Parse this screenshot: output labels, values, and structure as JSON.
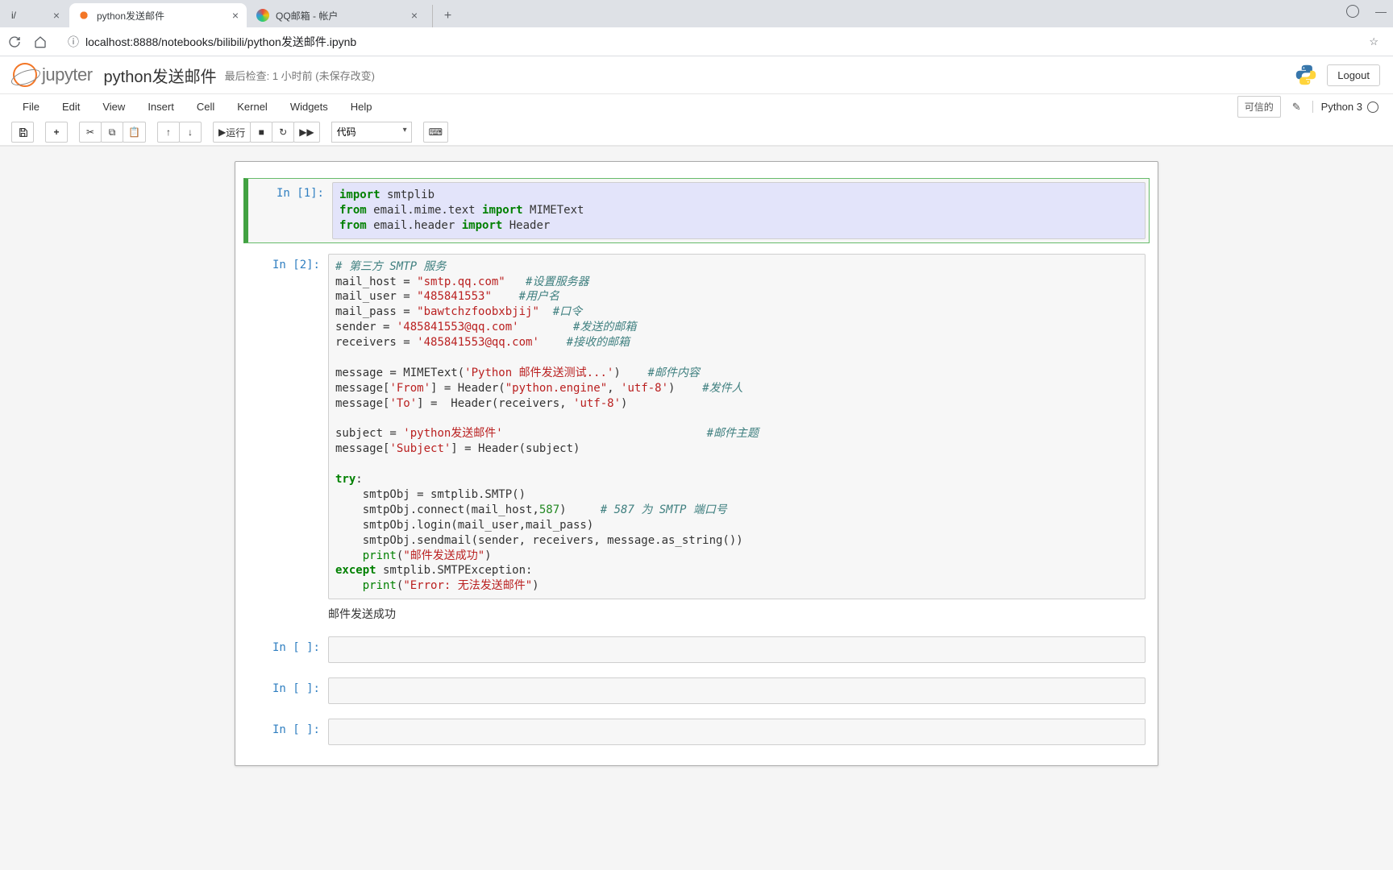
{
  "browser": {
    "tabs": [
      {
        "label": "i/",
        "active": false
      },
      {
        "label": "python发送邮件",
        "active": true
      },
      {
        "label": "QQ邮箱 - 帐户",
        "active": false
      }
    ],
    "url": "localhost:8888/notebooks/bilibili/python发送邮件.ipynb"
  },
  "jupyter": {
    "brand": "jupyter",
    "notebook_name": "python发送邮件",
    "checkpoint": "最后检查: 1 小时前 (未保存改变)",
    "logout": "Logout",
    "menus": [
      "File",
      "Edit",
      "View",
      "Insert",
      "Cell",
      "Kernel",
      "Widgets",
      "Help"
    ],
    "trusted": "可信的",
    "kernel_name": "Python 3",
    "toolbar": {
      "run_label": "运行",
      "cell_type": "代码"
    }
  },
  "cells": [
    {
      "prompt": "In [1]:",
      "selected": true,
      "source": {
        "l1_kw1": "import",
        "l1_rest": " smtplib",
        "l2_kw1": "from",
        "l2_mid": " email.mime.text ",
        "l2_kw2": "import",
        "l2_rest": " MIMEText",
        "l3_kw1": "from",
        "l3_mid": " email.header ",
        "l3_kw2": "import",
        "l3_rest": " Header"
      }
    },
    {
      "prompt": "In [2]:",
      "source_html": true,
      "output": "邮件发送成功"
    },
    {
      "prompt": "In [ ]:",
      "empty": true
    },
    {
      "prompt": "In [ ]:",
      "empty": true
    },
    {
      "prompt": "In [ ]:",
      "empty": true
    }
  ],
  "code2": {
    "c1": "# 第三方 SMTP 服务",
    "l2a": "mail_host = ",
    "l2s": "\"smtp.qq.com\"",
    "l2c": "   #设置服务器",
    "l3a": "mail_user = ",
    "l3s": "\"485841553\"",
    "l3c": "    #用户名",
    "l4a": "mail_pass = ",
    "l4s": "\"bawtchzfoobxbjij\"",
    "l4c": "  #口令",
    "l5a": "sender = ",
    "l5s": "'485841553@qq.com'",
    "l5c": "        #发送的邮箱",
    "l6a": "receivers = ",
    "l6s": "'485841553@qq.com'",
    "l6c": "    #接收的邮箱",
    "l8a": "message = MIMEText(",
    "l8s": "'Python 邮件发送测试...'",
    "l8b": ")    ",
    "l8c": "#邮件内容",
    "l9a": "message[",
    "l9s1": "'From'",
    "l9b": "] = Header(",
    "l9s2": "\"python.engine\"",
    "l9b2": ", ",
    "l9s3": "'utf-8'",
    "l9b3": ")    ",
    "l9c": "#发件人",
    "l10a": "message[",
    "l10s1": "'To'",
    "l10b": "] =  Header(receivers, ",
    "l10s2": "'utf-8'",
    "l10b2": ")",
    "l12a": "subject = ",
    "l12s": "'python发送邮件'",
    "l12sp": "                              ",
    "l12c": "#邮件主题",
    "l13a": "message[",
    "l13s": "'Subject'",
    "l13b": "] = Header(subject)",
    "l15kw": "try",
    "l15b": ":",
    "l16": "    smtpObj = smtplib.SMTP()",
    "l17a": "    smtpObj.connect(mail_host,",
    "l17n": "587",
    "l17b": ")     ",
    "l17c": "# 587 为 SMTP 端口号",
    "l18": "    smtpObj.login(mail_user,mail_pass)",
    "l19": "    smtpObj.sendmail(sender, receivers, message.as_string())",
    "l20a": "    ",
    "l20p": "print",
    "l20b": "(",
    "l20s": "\"邮件发送成功\"",
    "l20b2": ")",
    "l21kw": "except",
    "l21b": " smtplib.SMTPException:",
    "l22a": "    ",
    "l22p": "print",
    "l22b": "(",
    "l22s": "\"Error: 无法发送邮件\"",
    "l22b2": ")"
  }
}
